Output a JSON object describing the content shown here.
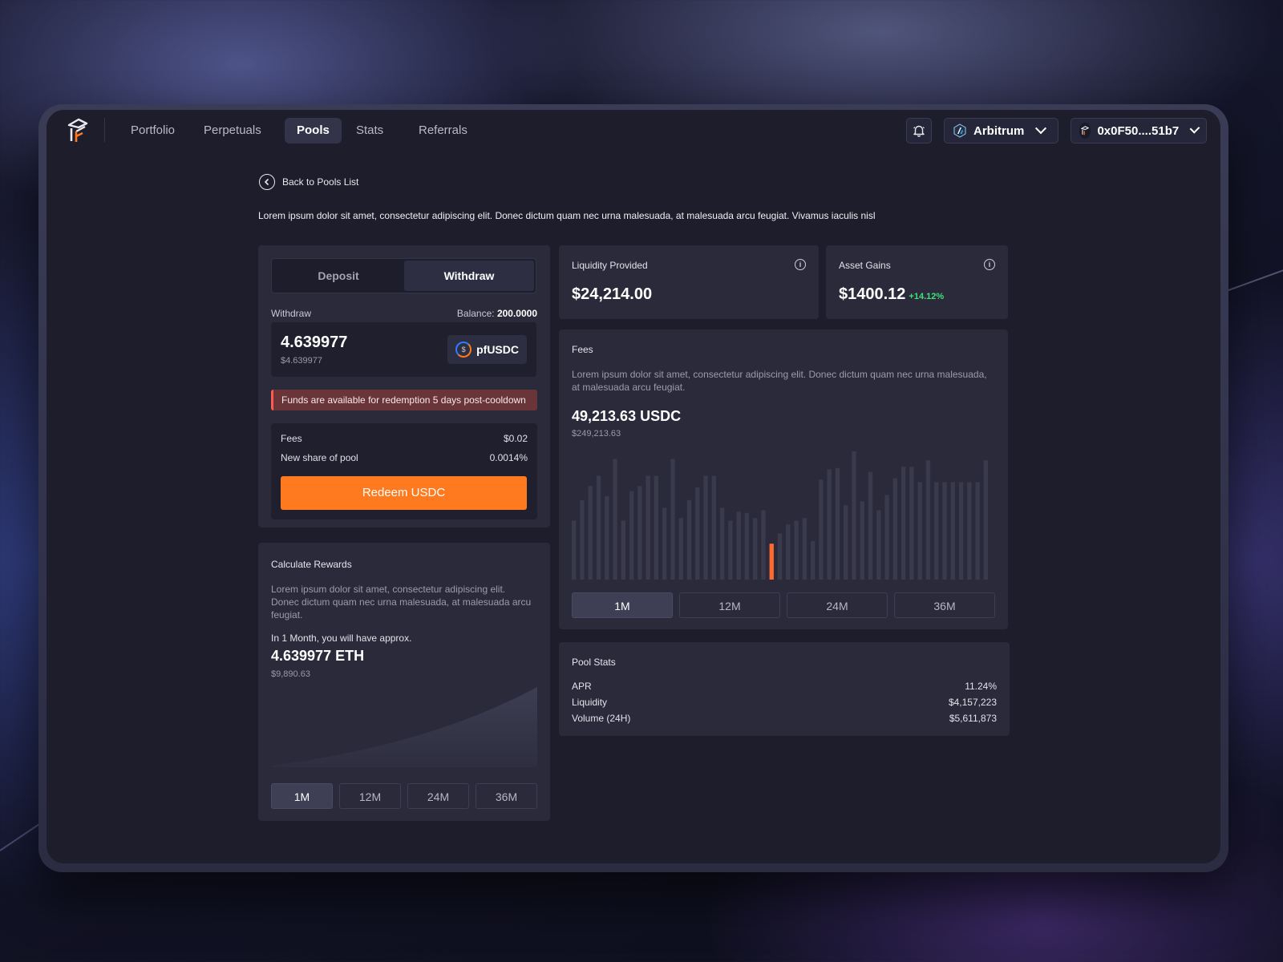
{
  "nav": {
    "items": [
      {
        "label": "Portfolio",
        "active": false
      },
      {
        "label": "Perpetuals",
        "active": false
      },
      {
        "label": "Pools",
        "active": true
      },
      {
        "label": "Stats",
        "active": false
      },
      {
        "label": "Referrals",
        "active": false
      }
    ],
    "network": "Arbitrum",
    "wallet": "0x0F50....51b7"
  },
  "back_label": "Back to Pools List",
  "intro_text": "Lorem ipsum dolor sit amet, consectetur adipiscing elit. Donec dictum quam nec urna malesuada, at malesuada arcu feugiat. Vivamus iaculis nisl",
  "trade": {
    "tabs": [
      "Deposit",
      "Withdraw"
    ],
    "active_tab": "Withdraw",
    "withdraw_label": "Withdraw",
    "balance_label": "Balance:",
    "balance_value": "200.0000",
    "amount": "4.639977",
    "amount_usd": "$4.639977",
    "token": "pfUSDC",
    "notice": "Funds are available for redemption 5 days post-cooldown",
    "fees_label": "Fees",
    "fees_value": "$0.02",
    "share_label": "New share of pool",
    "share_value": "0.0014%",
    "redeem_label": "Redeem USDC"
  },
  "calc": {
    "title": "Calculate Rewards",
    "description": "Lorem ipsum dolor sit amet, consectetur adipiscing elit. Donec dictum quam nec urna malesuada, at malesuada arcu feugiat.",
    "period_text": "In 1 Month, you will have approx.",
    "value": "4.639977 ETH",
    "value_usd": "$9,890.63",
    "ranges": [
      "1M",
      "12M",
      "24M",
      "36M"
    ],
    "selected_range": "1M"
  },
  "liquidity": {
    "label": "Liquidity Provided",
    "value": "$24,214.00"
  },
  "gains": {
    "label": "Asset Gains",
    "value": "$1400.12",
    "pct": "+14.12%"
  },
  "fees": {
    "title": "Fees",
    "description": "Lorem ipsum dolor sit amet, consectetur adipiscing elit. Donec dictum quam nec urna malesuada, at malesuada arcu feugiat.",
    "value": "49,213.63 USDC",
    "value_usd": "$249,213.63",
    "ranges": [
      "1M",
      "12M",
      "24M",
      "36M"
    ],
    "selected_range": "1M"
  },
  "pool_stats": {
    "title": "Pool Stats",
    "rows": [
      {
        "label": "APR",
        "value": "11.24%"
      },
      {
        "label": "Liquidity",
        "value": "$4,157,223"
      },
      {
        "label": "Volume (24H)",
        "value": "$5,611,873"
      }
    ]
  },
  "colors": {
    "accent": "#ff7a1f",
    "positive": "#3fe07a",
    "notice": "#6a3538",
    "bar": "#3a3a4d",
    "bar_highlight": "#ff6a2f"
  },
  "chart_data": {
    "type": "bar",
    "values": [
      46,
      62,
      73,
      81,
      65,
      94,
      46,
      69,
      73,
      81,
      81,
      56,
      94,
      48,
      62,
      72,
      81,
      81,
      56,
      46,
      53,
      52,
      48,
      54,
      28,
      36,
      43,
      46,
      48,
      30,
      78,
      86,
      87,
      58,
      100,
      61,
      84,
      54,
      66,
      79,
      88,
      88,
      76,
      93,
      76,
      76,
      76,
      76,
      76,
      76,
      93
    ],
    "highlight_index": 24,
    "ylim": [
      0,
      100
    ]
  }
}
